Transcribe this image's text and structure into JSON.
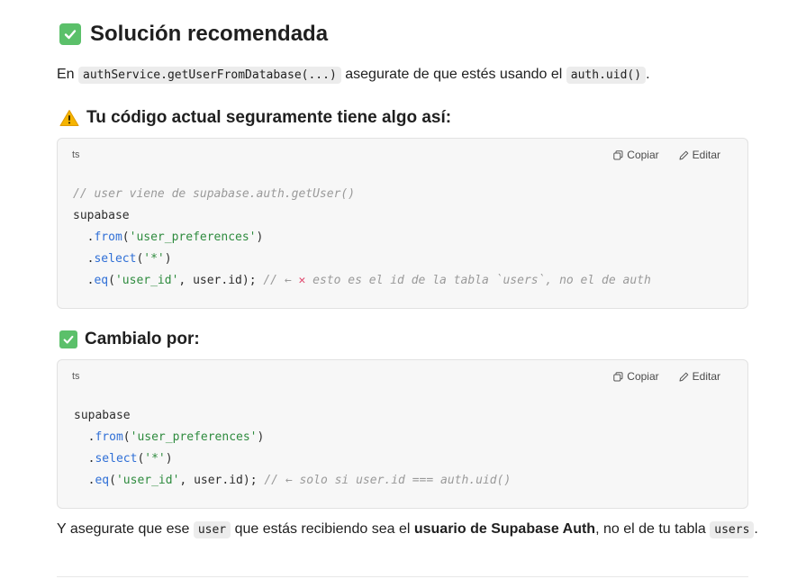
{
  "heading": "Solución recomendada",
  "intro": {
    "prefix": "En",
    "code1": "authService.getUserFromDatabase(...)",
    "middle": "asegurate de que estés usando el",
    "code2": "auth.uid()",
    "suffix": "."
  },
  "section1": {
    "icon": "warning-icon",
    "title": "Tu código actual seguramente tiene algo así:"
  },
  "codeblock1": {
    "lang": "ts",
    "copy_label": "Copiar",
    "edit_label": "Editar",
    "lines": {
      "l1": "// user viene de supabase.auth.getUser()",
      "l2": "supabase",
      "l3_a": "  .",
      "l3_fn": "from",
      "l3_b": "(",
      "l3_str": "'user_preferences'",
      "l3_c": ")",
      "l4_a": "  .",
      "l4_fn": "select",
      "l4_b": "(",
      "l4_str": "'*'",
      "l4_c": ")",
      "l5_a": "  .",
      "l5_fn": "eq",
      "l5_b": "(",
      "l5_str": "'user_id'",
      "l5_c": ", user.id); ",
      "l5_cm_a": "// ← ",
      "l5_x": "✕",
      "l5_cm_b": " esto es el id de la tabla `users`, no el de auth"
    }
  },
  "section2": {
    "icon": "check-icon",
    "title": "Cambialo por:"
  },
  "codeblock2": {
    "lang": "ts",
    "copy_label": "Copiar",
    "edit_label": "Editar",
    "lines": {
      "l1": "supabase",
      "l2_a": "  .",
      "l2_fn": "from",
      "l2_b": "(",
      "l2_str": "'user_preferences'",
      "l2_c": ")",
      "l3_a": "  .",
      "l3_fn": "select",
      "l3_b": "(",
      "l3_str": "'*'",
      "l3_c": ")",
      "l4_a": "  .",
      "l4_fn": "eq",
      "l4_b": "(",
      "l4_str": "'user_id'",
      "l4_c": ", user.id); ",
      "l4_cm": "// ← solo si user.id === auth.uid()"
    }
  },
  "outro": {
    "prefix": "Y asegurate que ese",
    "code1": "user",
    "middle": "que estás recibiendo sea el",
    "bold": "usuario de Supabase Auth",
    "after": ", no el de tu tabla",
    "code2": "users",
    "suffix": "."
  },
  "colors": {
    "check": "#5bc06a",
    "function": "#2f6fd6",
    "string": "#2e8b3e",
    "comment": "#9a9a9a",
    "cross": "#e0456c"
  }
}
